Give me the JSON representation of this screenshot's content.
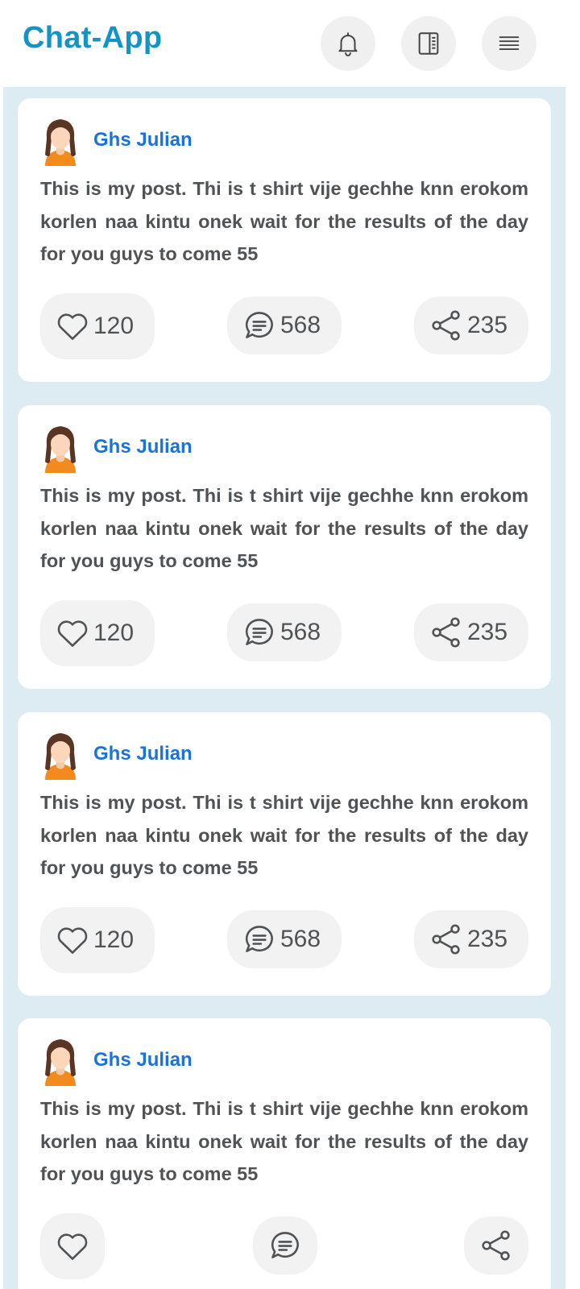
{
  "header": {
    "title": "Chat-App",
    "icons": [
      "bell-icon",
      "news-icon",
      "menu-icon"
    ]
  },
  "colors": {
    "brand": "#1493c6",
    "author": "#1a73d9",
    "feed_bg": "#ddecf2",
    "text": "#4f5356"
  },
  "posts": [
    {
      "author": "Ghs Julian",
      "text": "This is my post. Thi is t shirt vije gechhe knn erokom korlen naa kintu onek wait for the results of the day for you guys to come 55",
      "likes": "120",
      "comments": "568",
      "shares": "235"
    },
    {
      "author": "Ghs Julian",
      "text": "This is my post. Thi is t shirt vije gechhe knn erokom korlen naa kintu onek wait for the results of the day for you guys to come 55",
      "likes": "120",
      "comments": "568",
      "shares": "235"
    },
    {
      "author": "Ghs Julian",
      "text": "This is my post. Thi is t shirt vije gechhe knn erokom korlen naa kintu onek wait for the results of the day for you guys to come 55",
      "likes": "120",
      "comments": "568",
      "shares": "235"
    },
    {
      "author": "Ghs Julian",
      "text": "This is my post. Thi is t shirt vije gechhe knn erokom korlen naa kintu onek wait for the results of the day for you guys to come 55"
    }
  ]
}
